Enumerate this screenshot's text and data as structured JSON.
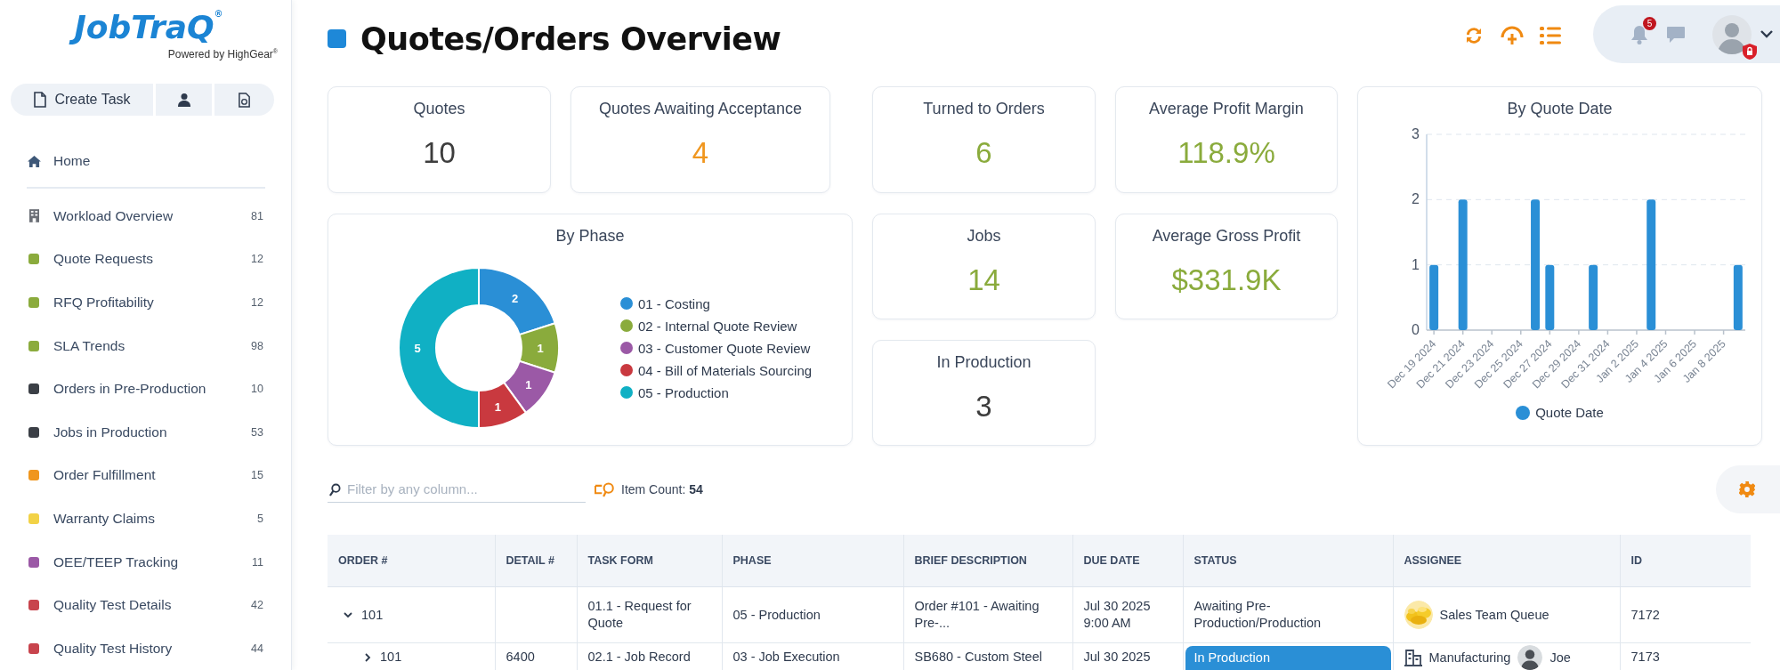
{
  "logo": {
    "name": "JobTraQ$^{®}$",
    "tagline": "Powered by HighGear$^{®}$"
  },
  "sidebar": {
    "create_button": "Create Task",
    "home": "Home",
    "items": [
      {
        "label": "Workload Overview",
        "count": "81",
        "kind": "building"
      },
      {
        "label": "Quote Requests",
        "count": "12",
        "kind": "square",
        "color": "#8bab3d"
      },
      {
        "label": "RFQ Profitability",
        "count": "12",
        "kind": "square",
        "color": "#8bab3d"
      },
      {
        "label": "SLA Trends",
        "count": "98",
        "kind": "square",
        "color": "#8bab3d"
      },
      {
        "label": "Orders in Pre-Production",
        "count": "10",
        "kind": "square",
        "color": "#3b3f46"
      },
      {
        "label": "Jobs in Production",
        "count": "53",
        "kind": "square",
        "color": "#3b3f46"
      },
      {
        "label": "Order Fulfillment",
        "count": "15",
        "kind": "square",
        "color": "#f0961e"
      },
      {
        "label": "Warranty Claims",
        "count": "5",
        "kind": "square",
        "color": "#f2d246"
      },
      {
        "label": "OEE/TEEP Tracking",
        "count": "11",
        "kind": "square",
        "color": "#9b59a6"
      },
      {
        "label": "Quality Test Details",
        "count": "42",
        "kind": "square",
        "color": "#c8444d"
      },
      {
        "label": "Quality Test History",
        "count": "44",
        "kind": "square",
        "color": "#c8444d"
      }
    ]
  },
  "header": {
    "title": "Quotes/Orders Overview",
    "notifications": "5"
  },
  "stats": [
    {
      "label": "Quotes",
      "value": "10",
      "color": "#3d3d3d"
    },
    {
      "label": "Quotes Awaiting Acceptance",
      "value": "4",
      "color": "#f0961e"
    },
    {
      "label": "Turned to Orders",
      "value": "6",
      "color": "#8aab3c"
    },
    {
      "label": "Average Profit Margin",
      "value": "118.9%",
      "color": "#8aab3c"
    },
    {
      "label": "Jobs",
      "value": "14",
      "color": "#8aab3c"
    },
    {
      "label": "Average Gross Profit",
      "value": "$331.9K",
      "color": "#8aab3c"
    },
    {
      "label": "In Production",
      "value": "3",
      "color": "#3d3d3d"
    }
  ],
  "phase_chart": {
    "chart_data": {
      "type": "donut",
      "title": "By Phase",
      "legend": "right",
      "categories": [
        "01 - Costing",
        "02 - Internal Quote Review",
        "03 - Customer Quote Review",
        "04 - Bill of Materials Sourcing",
        "05 - Production"
      ],
      "values": [
        2,
        1,
        1,
        1,
        5
      ],
      "colors": [
        "#2a8fd6",
        "#8aab3c",
        "#9b59a6",
        "#c9393f",
        "#10b0c4"
      ],
      "data_labels": true
    }
  },
  "date_chart": {
    "chart_data": {
      "type": "bar",
      "title": "By Quote Date",
      "legend": "bottom",
      "categories": [
        "Dec 19 2024",
        null,
        "Dec 21 2024",
        null,
        "Dec 23 2024",
        null,
        "Dec 25 2024",
        null,
        "Dec 27 2024",
        null,
        "Dec 29 2024",
        null,
        "Dec 31 2024",
        null,
        "Jan 2 2025",
        null,
        "Jan 4 2025",
        null,
        "Jan 6 2025",
        null,
        "Jan 8 2025",
        null
      ],
      "series": [
        {
          "name": "Quote Date",
          "color": "#2a8fd6",
          "values": [
            1,
            null,
            2,
            null,
            null,
            null,
            null,
            2,
            1,
            null,
            null,
            1,
            null,
            null,
            null,
            2,
            null,
            null,
            null,
            null,
            null,
            1
          ]
        }
      ],
      "ylim": [
        0,
        3
      ],
      "yticks": [
        0,
        1,
        2,
        3
      ]
    }
  },
  "filter": {
    "placeholder": "Filter by any column...",
    "count_label": "Item Count:",
    "count": "54"
  },
  "table": {
    "columns": [
      "ORDER #",
      "DETAIL #",
      "TASK FORM",
      "PHASE",
      "BRIEF DESCRIPTION",
      "DUE DATE",
      "STATUS",
      "ASSIGNEE",
      "ID"
    ],
    "rows": [
      {
        "order": "101",
        "expanded": true,
        "task_form": "01.1 - Request for Quote",
        "phase": "05 - Production",
        "description": "Order #101 - Awaiting Pre-...",
        "due_date": "Jul 30 2025 9:00 AM",
        "status": "Awaiting Pre-Production/Production",
        "highlighted": false,
        "assignees": [
          {
            "name": "Sales Team Queue",
            "kind": "queue"
          }
        ],
        "id": "7172",
        "children": [
          {
            "order": "101",
            "expanded": false,
            "detail": "6400",
            "task_form": "02.1 - Job Record",
            "phase": "03 - Job Execution",
            "description": "SB680 - Custom Steel",
            "due_date": "Jul 30 2025",
            "status": "In Production",
            "highlighted": true,
            "assignees": [
              {
                "name": "Manufacturing",
                "kind": "team"
              },
              {
                "name": "Joe",
                "kind": "person"
              }
            ],
            "id": "7173"
          }
        ]
      }
    ]
  }
}
